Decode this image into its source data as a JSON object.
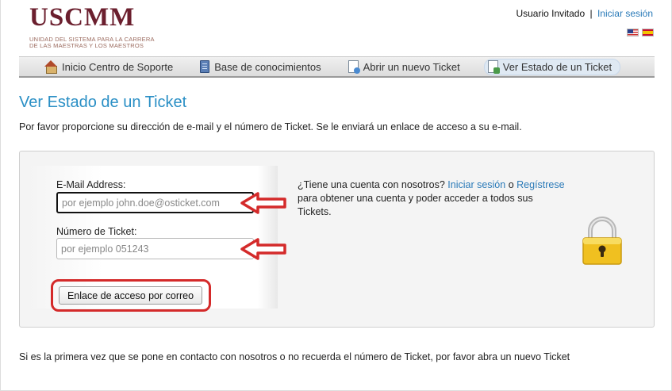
{
  "header": {
    "logo_title": "USCMM",
    "logo_subtitle_line1": "UNIDAD DEL SISTEMA PARA LA CARRERA",
    "logo_subtitle_line2": "DE LAS MAESTRAS Y LOS MAESTROS",
    "user_label": "Usuario Invitado",
    "separator": "|",
    "login_link": "Iniciar sesión",
    "flags": [
      "flag-us-icon",
      "flag-es-icon"
    ]
  },
  "nav": {
    "items": [
      {
        "label": "Inicio Centro de Soporte",
        "icon": "home-icon"
      },
      {
        "label": "Base de conocimientos",
        "icon": "book-icon"
      },
      {
        "label": "Abrir un nuevo Ticket",
        "icon": "new-ticket-icon"
      },
      {
        "label": "Ver Estado de un Ticket",
        "icon": "ticket-status-icon",
        "active": true
      }
    ]
  },
  "main": {
    "title": "Ver Estado de un Ticket",
    "intro": "Por favor proporcione su dirección de e-mail y el número de Ticket. Se le enviará un enlace de acceso a su e-mail.",
    "form": {
      "email_label": "E-Mail Address:",
      "email_placeholder": "por ejemplo john.doe@osticket.com",
      "email_value": "",
      "ticket_label": "Número de Ticket:",
      "ticket_placeholder": "por ejemplo 051243",
      "ticket_value": "",
      "submit_label": "Enlace de acceso por correo"
    },
    "help": {
      "prefix": "¿Tiene una cuenta con nosotros?",
      "login_link": "Iniciar sesión",
      "conjunction": "o",
      "register_link": "Regístrese",
      "suffix": "para obtener una cuenta y poder acceder a todos sus Tickets."
    },
    "footer": "Si es la primera vez que se pone en contacto con nosotros o no recuerda el número de Ticket, por favor abra un nuevo Ticket"
  },
  "colors": {
    "brand": "#6b1f2e",
    "title_blue": "#2a8fc5",
    "link_blue": "#2a7ab8",
    "annotation_red": "#d42a2a",
    "lock_gold": "#f0c020"
  }
}
